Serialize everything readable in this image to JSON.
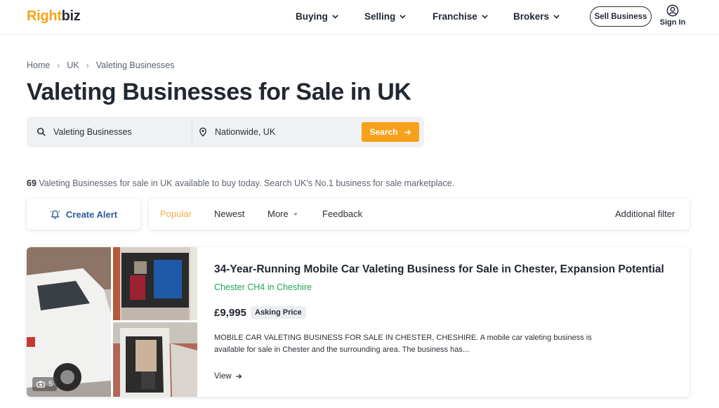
{
  "header": {
    "logo_part1": "Right",
    "logo_part2": "biz",
    "nav": [
      "Buying",
      "Selling",
      "Franchise",
      "Brokers"
    ],
    "sell_button": "Sell Business",
    "signin_label": "Sign In"
  },
  "breadcrumb": [
    "Home",
    "UK",
    "Valeting Businesses"
  ],
  "page_title": "Valeting Businesses for Sale in UK",
  "search": {
    "keyword_value": "Valeting Businesses",
    "location_value": "Nationwide, UK",
    "button_label": "Search"
  },
  "results": {
    "count": "69",
    "text": " Valeting Businesses for sale in UK available to buy today. Search UK's No.1 business for sale marketplace."
  },
  "filters": {
    "create_alert": "Create Alert",
    "sort_options": [
      "Popular",
      "Newest",
      "More",
      "Feedback"
    ],
    "active_sort": "Popular",
    "additional_filter": "Additional filter"
  },
  "listing": {
    "title": "34-Year-Running Mobile Car Valeting Business for Sale in Chester, Expansion Potential",
    "location": "Chester CH4 in Cheshire",
    "price": "£9,995",
    "price_label": "Asking Price",
    "description": "MOBILE CAR VALETING BUSINESS FOR SALE IN CHESTER, CHESHIRE. A mobile car valeting business is available for sale in Chester and the surrounding area. The business has...",
    "view_label": "View",
    "photo_count": "5"
  },
  "colors": {
    "accent": "#f7a01a",
    "link_blue": "#2e5b9a",
    "location_green": "#23a35a"
  }
}
